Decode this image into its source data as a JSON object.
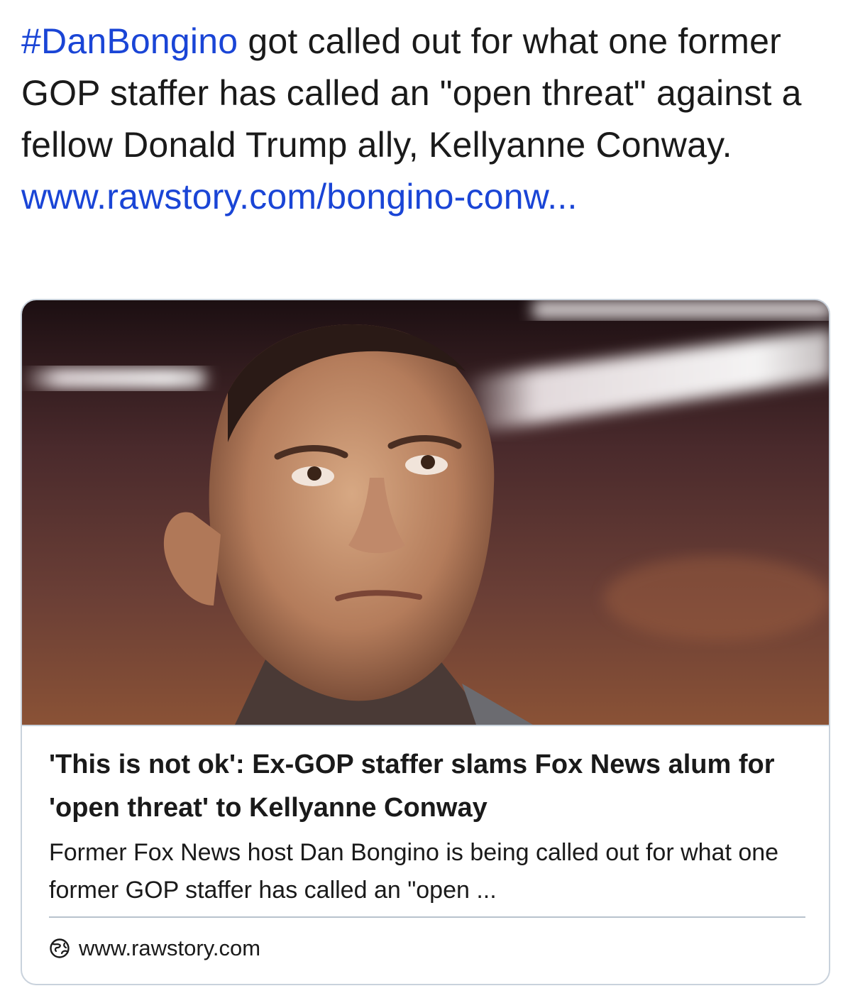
{
  "post": {
    "hashtag": "#DanBongino",
    "text": " got called out for what one former GOP staffer has called an \"open threat\" against a fellow Donald Trump ally, Kellyanne Conway.",
    "link": "www.rawstory.com/bongino-conw..."
  },
  "card": {
    "image_alt_icon": "photo-of-man-looking-up",
    "title": "'This is not ok': Ex-GOP staffer slams Fox News alum for 'open threat' to Kellyanne Conway",
    "description": "Former Fox News host Dan Bongino is being called out for what one former GOP staffer has called an \"open ...",
    "source_icon": "globe-icon",
    "source": "www.rawstory.com"
  },
  "colors": {
    "link": "#1a45d6",
    "border": "#c9d2dc",
    "text": "#1a1a1a"
  }
}
